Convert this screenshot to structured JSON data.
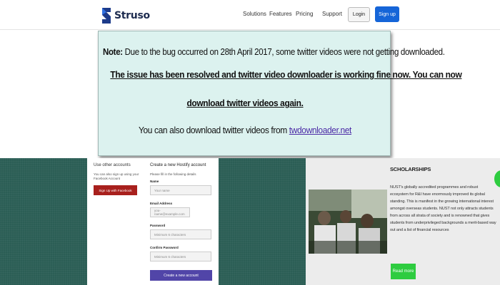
{
  "nav": {
    "brand": "Struso",
    "links": [
      "Solutions",
      "Features",
      "Pricing",
      "Support"
    ],
    "login_label": "Login",
    "signup_label": "Sign up"
  },
  "notice": {
    "note_label": "Note:",
    "line1": " Due to the bug occurred on 28th April 2017, some twitter videos were not getting downloaded.",
    "line2": "The issue has been resolved and twitter video downloader is working fine now. You can now",
    "line3": "download twitter videos again.",
    "line4_prefix": "You can also download twitter videos from ",
    "line4_link": "twdownloader.net"
  },
  "social": {
    "title": "Use other accounts",
    "text": "You can also sign up using your Facebook Account",
    "facebook_button": "Sign Up with Facebook"
  },
  "form": {
    "title": "Create a new Hostify account",
    "subtitle": "Please fill in the following details",
    "name_label": "Name",
    "name_placeholder": "Your name",
    "email_label": "Email Address",
    "email_placeholder": "you-name@example.com",
    "password_label": "Password",
    "password_placeholder": "Minimum 6 characters",
    "confirm_label": "Confirm Password",
    "confirm_placeholder": "Minimum 6 characters",
    "create_button": "Create a new account"
  },
  "scholarship": {
    "title": "SCHOLARSHIPS",
    "text": "NUST's globally accredited programmes and robust ecosystem for R&I have enormously improved its global standing. This is manifest in the growing international interest amongst overseas students. NUST not only attracts students from across all strata of society and is renowned that gives students from underprivileged backgrounds a merit-based way out and a list of financial resources",
    "read_more": "Read more"
  },
  "colors": {
    "accent": "#1565d8",
    "notice_bg": "#dcf2ef",
    "panel_green": "#2b5e55",
    "facebook_red": "#a8201d",
    "form_purple": "#5145a8",
    "read_more_green": "#2ecc40"
  }
}
